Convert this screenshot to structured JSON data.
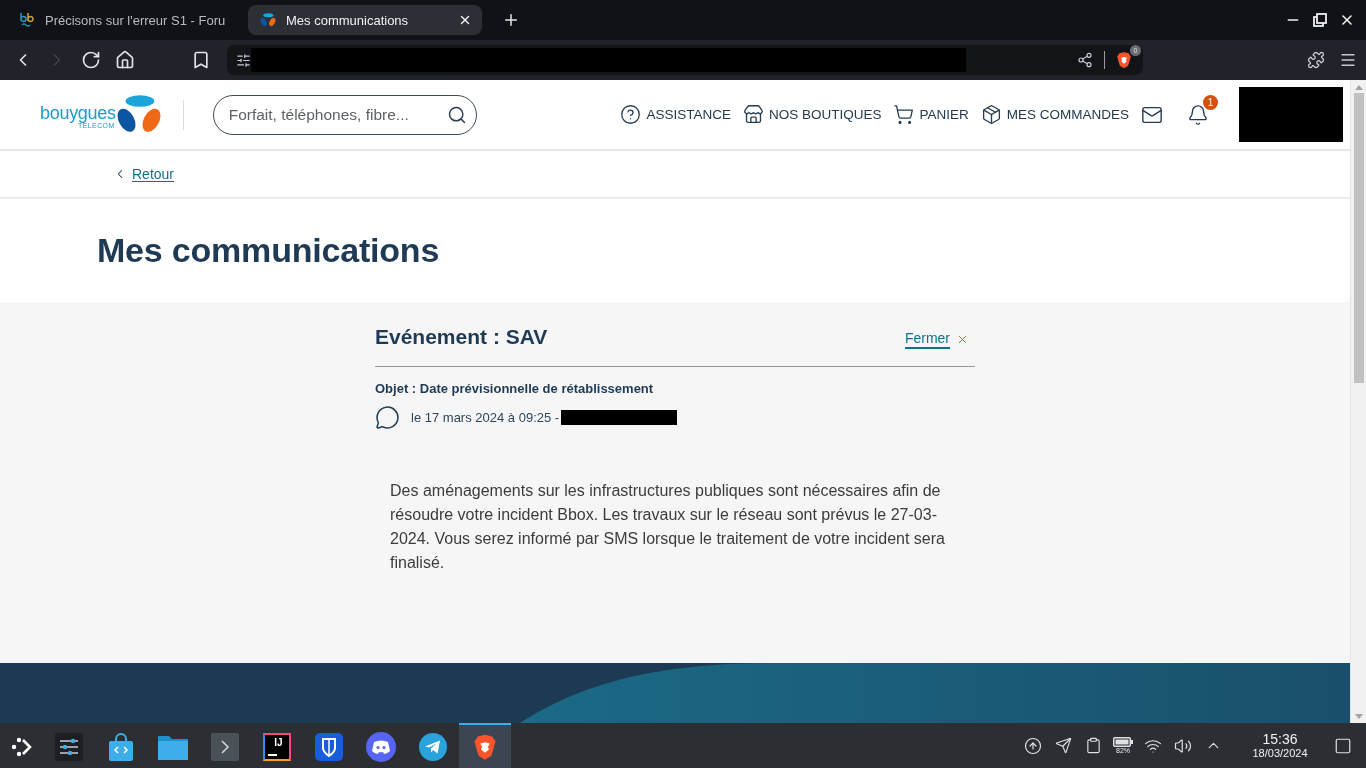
{
  "browser": {
    "tabs": [
      {
        "kind": "forum",
        "title": "Précisons sur l'erreur S1 - Foru",
        "selected": false
      },
      {
        "kind": "shop",
        "title": "Mes communications",
        "selected": true
      }
    ],
    "toolbar": [
      {
        "kind": "back",
        "disabled": false
      },
      {
        "kind": "forward",
        "disabled": true
      },
      {
        "kind": "reload",
        "disabled": false
      },
      {
        "kind": "home",
        "disabled": false
      },
      {
        "kind": "bookmark",
        "disabled": false
      }
    ],
    "shields_badge": "0"
  },
  "site_header": {
    "logo": {
      "name": "bouygues",
      "tagline": "TELECOM"
    },
    "search": {
      "placeholder": "Forfait, téléphones, fibre..."
    },
    "nav": [
      {
        "kind": "help",
        "label": "ASSISTANCE"
      },
      {
        "kind": "store",
        "label": "NOS BOUTIQUES"
      },
      {
        "kind": "cart",
        "label": "PANIER"
      },
      {
        "kind": "box",
        "label": "MES COMMANDES"
      },
      {
        "kind": "mail"
      },
      {
        "kind": "bell",
        "badge": "1"
      }
    ]
  },
  "breadcrumb": {
    "back_link": "Retour"
  },
  "page_title": "Mes communications",
  "message": {
    "title": "Evénement : SAV",
    "close_label": "Fermer",
    "subject": "Objet : Date prévisionnelle de rétablissement",
    "meta": "le 17 mars 2024 à 09:25 -",
    "body": "Des aménagements sur les infrastructures publiques sont nécessaires afin de résoudre votre incident Bbox. Les travaux sur le réseau sont prévus le 27-03-2024. Vous serez informé par SMS lorsque le traitement de votre incident sera finalisé."
  },
  "taskbar": {
    "apps": [
      {
        "kind": "launcher",
        "selected": false
      },
      {
        "kind": "settings",
        "selected": false
      },
      {
        "kind": "store",
        "selected": false
      },
      {
        "kind": "files",
        "selected": false
      },
      {
        "kind": "terminal",
        "selected": false
      },
      {
        "kind": "ide",
        "label": "IJ",
        "selected": false
      },
      {
        "kind": "passwords",
        "selected": false
      },
      {
        "kind": "chat",
        "selected": false
      },
      {
        "kind": "messenger",
        "selected": false
      },
      {
        "kind": "browser",
        "selected": true
      }
    ],
    "tray": [
      {
        "kind": "update"
      },
      {
        "kind": "messenger"
      },
      {
        "kind": "clipboard"
      },
      {
        "kind": "battery",
        "reading": "82%"
      },
      {
        "kind": "wifi"
      },
      {
        "kind": "volume"
      },
      {
        "kind": "expand"
      }
    ],
    "clock": {
      "time": "15:36",
      "date": "18/03/2024"
    }
  }
}
